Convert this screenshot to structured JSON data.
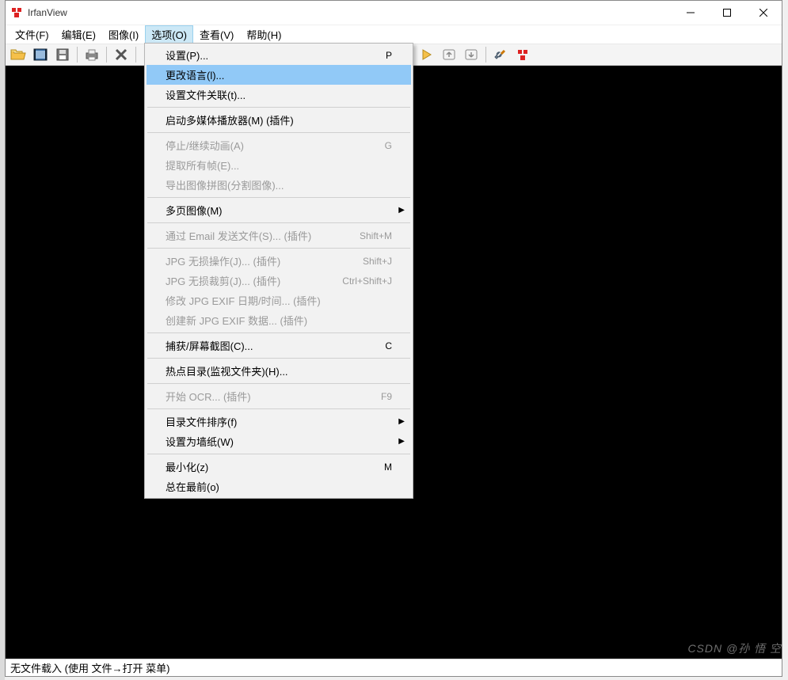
{
  "window": {
    "title": "IrfanView"
  },
  "menubar": {
    "items": [
      {
        "label": "文件(F)"
      },
      {
        "label": "编辑(E)"
      },
      {
        "label": "图像(I)"
      },
      {
        "label": "选项(O)",
        "active": true
      },
      {
        "label": "查看(V)"
      },
      {
        "label": "帮助(H)"
      }
    ]
  },
  "toolbar_icons": {
    "open": "folder-open-icon",
    "thumbnails": "film-icon",
    "save": "floppy-icon",
    "print": "printer-icon",
    "delete": "x-icon",
    "cut": "scissors-icon",
    "copy": "copy-icon",
    "paste": "clipboard-icon",
    "undo": "undo-icon",
    "info": "info-icon",
    "prev": "arrow-left-icon",
    "next": "arrow-right-icon",
    "first": "first-icon",
    "last": "last-icon",
    "settings": "wrench-icon",
    "about": "puzzle-icon"
  },
  "dropdown": {
    "items": [
      {
        "label": "设置(P)...",
        "shortcut": "P"
      },
      {
        "label": "更改语言(l)...",
        "highlight": true
      },
      {
        "label": "设置文件关联(t)..."
      },
      {
        "sep": true
      },
      {
        "label": "启动多媒体播放器(M) (插件)"
      },
      {
        "sep": true
      },
      {
        "label": "停止/继续动画(A)",
        "shortcut": "G",
        "disabled": true
      },
      {
        "label": "提取所有帧(E)...",
        "disabled": true
      },
      {
        "label": "导出图像拼图(分割图像)...",
        "disabled": true
      },
      {
        "sep": true
      },
      {
        "label": "多页图像(M)",
        "submenu": true
      },
      {
        "sep": true
      },
      {
        "label": "通过 Email 发送文件(S)... (插件)",
        "shortcut": "Shift+M",
        "disabled": true
      },
      {
        "sep": true
      },
      {
        "label": "JPG 无损操作(J)... (插件)",
        "shortcut": "Shift+J",
        "disabled": true
      },
      {
        "label": "JPG 无损裁剪(J)... (插件)",
        "shortcut": "Ctrl+Shift+J",
        "disabled": true
      },
      {
        "label": "修改 JPG EXIF 日期/时间... (插件)",
        "disabled": true
      },
      {
        "label": "创建新 JPG EXIF 数据... (插件)",
        "disabled": true
      },
      {
        "sep": true
      },
      {
        "label": "捕获/屏幕截图(C)...",
        "shortcut": "C"
      },
      {
        "sep": true
      },
      {
        "label": "热点目录(监视文件夹)(H)..."
      },
      {
        "sep": true
      },
      {
        "label": "开始 OCR... (插件)",
        "shortcut": "F9",
        "disabled": true
      },
      {
        "sep": true
      },
      {
        "label": "目录文件排序(f)",
        "submenu": true
      },
      {
        "label": "设置为墙纸(W)",
        "submenu": true
      },
      {
        "sep": true
      },
      {
        "label": "最小化(z)",
        "shortcut": "M"
      },
      {
        "label": "总在最前(o)"
      }
    ]
  },
  "statusbar": {
    "text": "无文件载入 (使用 文件→打开 菜单)"
  },
  "watermark": "CSDN @孙 悟 空"
}
